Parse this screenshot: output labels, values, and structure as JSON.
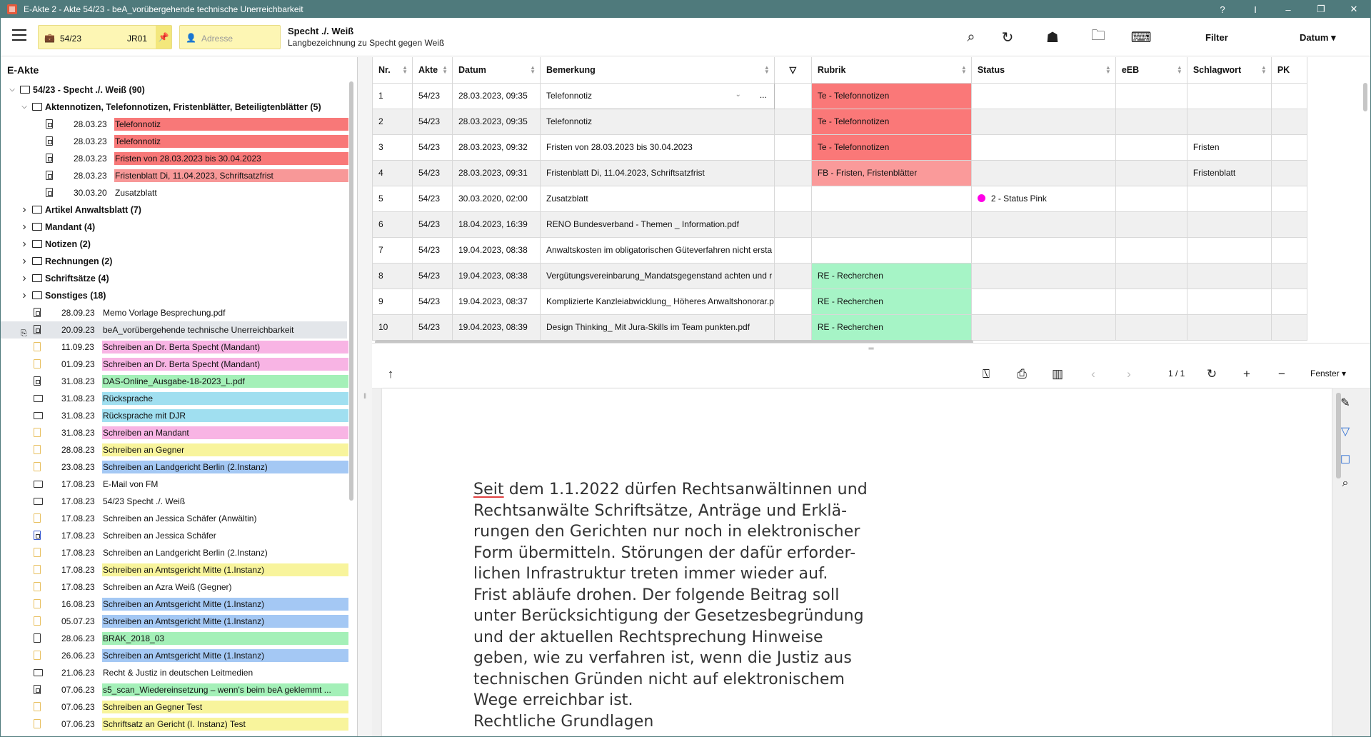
{
  "window": {
    "title": "E-Akte 2 - Akte 54/23 - beA_vorübergehende technische Unerreichbarkeit",
    "controls": [
      "?",
      "I",
      "–",
      "❐",
      "✕"
    ]
  },
  "toolbar": {
    "akte_number": "54/23",
    "akte_ref": "JR01",
    "address_placeholder": "Adresse",
    "case_title": "Specht ./. Weiß",
    "case_subtitle": "Langbezeichnung zu Specht gegen Weiß",
    "filter_label": "Filter",
    "sort_label": "Datum",
    "icons": [
      "search-icon",
      "refresh-icon",
      "basket-icon",
      "folder-icon",
      "keyboard-icon"
    ]
  },
  "tree": {
    "title": "E-Akte",
    "root": "54/23 - Specht ./. Weiß (90)",
    "group1": "Aktennotizen, Telefonnotizen, Fristenblätter, Beteiligtenblätter (5)",
    "group1_items": [
      {
        "date": "28.03.23",
        "text": "Telefonnotiz",
        "color": "#f87878"
      },
      {
        "date": "28.03.23",
        "text": "Telefonnotiz",
        "color": "#f87878"
      },
      {
        "date": "28.03.23",
        "text": "Fristen von 28.03.2023 bis 30.04.2023",
        "color": "#f87878"
      },
      {
        "date": "28.03.23",
        "text": "Fristenblatt Di, 11.04.2023, Schriftsatzfrist",
        "color": "#f89898"
      },
      {
        "date": "30.03.20",
        "text": "Zusatzblatt",
        "color": ""
      }
    ],
    "folders": [
      "Artikel Anwaltsblatt (7)",
      "Mandant (4)",
      "Notizen (2)",
      "Rechnungen (2)",
      "Schriftsätze (4)",
      "Sonstiges (18)"
    ],
    "docs": [
      {
        "date": "28.09.23",
        "text": "Memo Vorlage Besprechung.pdf",
        "color": "",
        "icon": "pdf"
      },
      {
        "date": "20.09.23",
        "text": "beA_vorübergehende technische Unerreichbarkeit",
        "color": "",
        "icon": "pdf",
        "selected": true
      },
      {
        "date": "11.09.23",
        "text": "Schreiben an Dr. Berta Specht (Mandant)",
        "color": "#f8b4e4",
        "icon": "word"
      },
      {
        "date": "01.09.23",
        "text": "Schreiben an Dr. Berta Specht (Mandant)",
        "color": "#f8b4e4",
        "icon": "word"
      },
      {
        "date": "31.08.23",
        "text": "DAS-Online_Ausgabe-18-2023_L.pdf",
        "color": "#a4f0b8",
        "icon": "pdf"
      },
      {
        "date": "31.08.23",
        "text": "Rücksprache",
        "color": "#a0dff0",
        "icon": "mail"
      },
      {
        "date": "31.08.23",
        "text": "Rücksprache mit DJR",
        "color": "#a0dff0",
        "icon": "mail"
      },
      {
        "date": "31.08.23",
        "text": "Schreiben an Mandant",
        "color": "#f8b4e4",
        "icon": "word"
      },
      {
        "date": "28.08.23",
        "text": "Schreiben an Gegner",
        "color": "#f8f49c",
        "icon": "word"
      },
      {
        "date": "23.08.23",
        "text": "Schreiben an Landgericht Berlin (2.Instanz)",
        "color": "#a4c8f4",
        "icon": "word"
      },
      {
        "date": "17.08.23",
        "text": "E-Mail von FM",
        "color": "",
        "icon": "mail"
      },
      {
        "date": "17.08.23",
        "text": "54/23 Specht ./. Weiß",
        "color": "",
        "icon": "mail"
      },
      {
        "date": "17.08.23",
        "text": "Schreiben an Jessica Schäfer (Anwältin)",
        "color": "",
        "icon": "word"
      },
      {
        "date": "17.08.23",
        "text": "Schreiben an Jessica Schäfer",
        "color": "",
        "icon": "blue"
      },
      {
        "date": "17.08.23",
        "text": "Schreiben an Landgericht Berlin (2.Instanz)",
        "color": "",
        "icon": "word"
      },
      {
        "date": "17.08.23",
        "text": "Schreiben an Amtsgericht Mitte (1.Instanz)",
        "color": "#f8f49c",
        "icon": "word"
      },
      {
        "date": "17.08.23",
        "text": "Schreiben an Azra Weiß (Gegner)",
        "color": "",
        "icon": "word"
      },
      {
        "date": "16.08.23",
        "text": "Schreiben an Amtsgericht Mitte (1.Instanz)",
        "color": "#a4c8f4",
        "icon": "word"
      },
      {
        "date": "05.07.23",
        "text": "Schreiben an Amtsgericht Mitte (1.Instanz)",
        "color": "#a4c8f4",
        "icon": "word"
      },
      {
        "date": "28.06.23",
        "text": "BRAK_2018_03",
        "color": "#a4f0b8",
        "icon": "doc"
      },
      {
        "date": "26.06.23",
        "text": "Schreiben an Amtsgericht Mitte (1.Instanz)",
        "color": "#a4c8f4",
        "icon": "word"
      },
      {
        "date": "21.06.23",
        "text": "Recht & Justiz in deutschen Leitmedien",
        "color": "",
        "icon": "mail"
      },
      {
        "date": "07.06.23",
        "text": "s5_scan_Wiedereinsetzung – wenn's beim beA geklemmt ...",
        "color": "#a4f0b8",
        "icon": "pdf"
      },
      {
        "date": "07.06.23",
        "text": "Schreiben an Gegner Test",
        "color": "#f8f49c",
        "icon": "word"
      },
      {
        "date": "07.06.23",
        "text": "Schriftsatz an Gericht (I. Instanz) Test",
        "color": "#f8f49c",
        "icon": "word"
      }
    ]
  },
  "grid": {
    "columns": [
      "Nr.",
      "Akte",
      "Datum",
      "Bemerkung",
      "",
      "Rubrik",
      "Status",
      "eEB",
      "Schlagwort",
      "PK"
    ],
    "rows": [
      {
        "nr": "1",
        "akte": "54/23",
        "datum": "28.03.2023, 09:35",
        "bemerkung": "Telefonnotiz",
        "rubrik": "Te - Telefonnotizen",
        "rubrik_color": "#fa7878",
        "status": "",
        "schlagwort": ""
      },
      {
        "nr": "2",
        "akte": "54/23",
        "datum": "28.03.2023, 09:35",
        "bemerkung": "Telefonnotiz",
        "rubrik": "Te - Telefonnotizen",
        "rubrik_color": "#fa7878",
        "status": "",
        "schlagwort": ""
      },
      {
        "nr": "3",
        "akte": "54/23",
        "datum": "28.03.2023, 09:32",
        "bemerkung": "Fristen von 28.03.2023 bis 30.04.2023",
        "rubrik": "Te - Telefonnotizen",
        "rubrik_color": "#fa7878",
        "status": "",
        "schlagwort": "Fristen"
      },
      {
        "nr": "4",
        "akte": "54/23",
        "datum": "28.03.2023, 09:31",
        "bemerkung": "Fristenblatt Di, 11.04.2023, Schriftsatzfrist",
        "rubrik": "FB - Fristen, Fristenblätter",
        "rubrik_color": "#fa9a9a",
        "status": "",
        "schlagwort": "Fristenblatt"
      },
      {
        "nr": "5",
        "akte": "54/23",
        "datum": "30.03.2020, 02:00",
        "bemerkung": "Zusatzblatt",
        "rubrik": "",
        "rubrik_color": "",
        "status": "2 - Status Pink",
        "schlagwort": ""
      },
      {
        "nr": "6",
        "akte": "54/23",
        "datum": "18.04.2023, 16:39",
        "bemerkung": "RENO Bundesverband - Themen _ Information.pdf",
        "rubrik": "",
        "rubrik_color": "",
        "status": "",
        "schlagwort": ""
      },
      {
        "nr": "7",
        "akte": "54/23",
        "datum": "19.04.2023, 08:38",
        "bemerkung": "Anwaltskosten im obligatorischen Güteverfahren nicht ersta",
        "rubrik": "",
        "rubrik_color": "",
        "status": "",
        "schlagwort": ""
      },
      {
        "nr": "8",
        "akte": "54/23",
        "datum": "19.04.2023, 08:38",
        "bemerkung": "Vergütungsvereinbarung_Mandatsgegenstand achten und r",
        "rubrik": "RE - Recherchen",
        "rubrik_color": "#a6f4c6",
        "status": "",
        "schlagwort": ""
      },
      {
        "nr": "9",
        "akte": "54/23",
        "datum": "19.04.2023, 08:37",
        "bemerkung": "Komplizierte Kanzleiabwicklung_ Höheres Anwaltshonorar.p",
        "rubrik": "RE - Recherchen",
        "rubrik_color": "#a6f4c6",
        "status": "",
        "schlagwort": ""
      },
      {
        "nr": "10",
        "akte": "54/23",
        "datum": "19.04.2023, 08:39",
        "bemerkung": "Design Thinking_ Mit Jura-Skills im Team punkten.pdf",
        "rubrik": "RE - Recherchen",
        "rubrik_color": "#a6f4c6",
        "status": "",
        "schlagwort": ""
      }
    ]
  },
  "viewer": {
    "page_indicator": "1 / 1",
    "zoom_label": "Fenster",
    "text_lines": [
      "Seit dem 1.1.2022 dürfen Rechtsanwältinnen und",
      "Rechtsanwälte Schriftsätze, Anträge und Erklä-",
      "rungen den Gerichten nur noch in elektronischer",
      "Form übermitteln. Störungen der dafür erforder-",
      "lichen Infrastruktur treten immer wieder auf.",
      "Frist abläufe drohen. Der folgende Beitrag soll",
      "unter Berücksichtigung der Gesetzesbegründung",
      "und der aktuellen Rechtsprechung Hinweise",
      "geben, wie zu verfahren ist, wenn die Justiz aus",
      "technischen Gründen nicht auf elektronischem",
      "Wege erreichbar ist.",
      "Rechtliche Grundlagen"
    ]
  }
}
